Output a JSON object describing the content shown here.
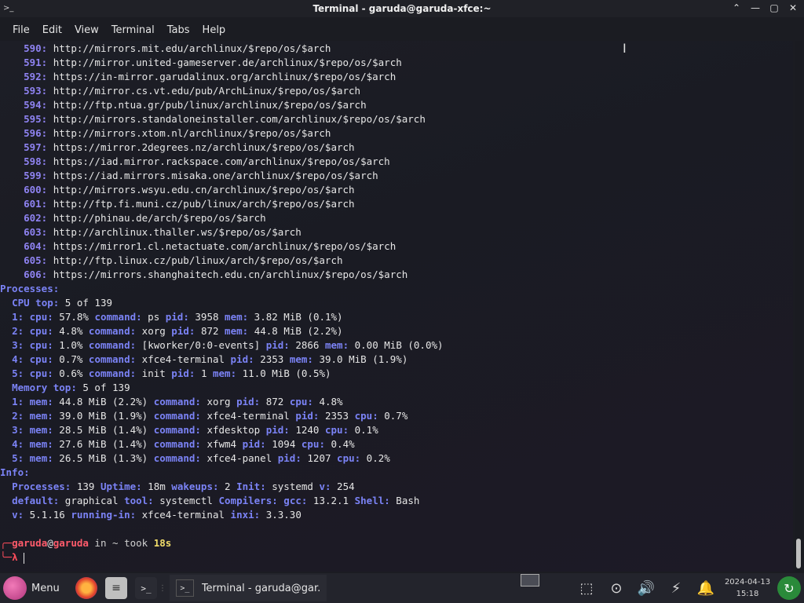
{
  "window": {
    "title": "Terminal - garuda@garuda-xfce:~"
  },
  "menu": [
    "File",
    "Edit",
    "View",
    "Terminal",
    "Tabs",
    "Help"
  ],
  "terminal": {
    "mirrors": [
      {
        "num": "590:",
        "url": "http://mirrors.mit.edu/archlinux/$repo/os/$arch"
      },
      {
        "num": "591:",
        "url": "http://mirror.united-gameserver.de/archlinux/$repo/os/$arch"
      },
      {
        "num": "592:",
        "url": "https://in-mirror.garudalinux.org/archlinux/$repo/os/$arch"
      },
      {
        "num": "593:",
        "url": "http://mirror.cs.vt.edu/pub/ArchLinux/$repo/os/$arch"
      },
      {
        "num": "594:",
        "url": "http://ftp.ntua.gr/pub/linux/archlinux/$repo/os/$arch"
      },
      {
        "num": "595:",
        "url": "http://mirrors.standaloneinstaller.com/archlinux/$repo/os/$arch"
      },
      {
        "num": "596:",
        "url": "http://mirrors.xtom.nl/archlinux/$repo/os/$arch"
      },
      {
        "num": "597:",
        "url": "https://mirror.2degrees.nz/archlinux/$repo/os/$arch"
      },
      {
        "num": "598:",
        "url": "https://iad.mirror.rackspace.com/archlinux/$repo/os/$arch"
      },
      {
        "num": "599:",
        "url": "https://iad.mirrors.misaka.one/archlinux/$repo/os/$arch"
      },
      {
        "num": "600:",
        "url": "http://mirrors.wsyu.edu.cn/archlinux/$repo/os/$arch"
      },
      {
        "num": "601:",
        "url": "http://ftp.fi.muni.cz/pub/linux/arch/$repo/os/$arch"
      },
      {
        "num": "602:",
        "url": "http://phinau.de/arch/$repo/os/$arch"
      },
      {
        "num": "603:",
        "url": "http://archlinux.thaller.ws/$repo/os/$arch"
      },
      {
        "num": "604:",
        "url": "https://mirror1.cl.netactuate.com/archlinux/$repo/os/$arch"
      },
      {
        "num": "605:",
        "url": "http://ftp.linux.cz/pub/linux/arch/$repo/os/$arch"
      },
      {
        "num": "606:",
        "url": "https://mirrors.shanghaitech.edu.cn/archlinux/$repo/os/$arch"
      }
    ],
    "processes_header": "Processes:",
    "cpu_top": {
      "label": "CPU top:",
      "value": "5 of 139"
    },
    "cpu_rows": [
      {
        "n": "1:",
        "cpu": "57.8%",
        "command": "ps",
        "pid": "3958",
        "mem": "3.82 MiB (0.1%)"
      },
      {
        "n": "2:",
        "cpu": "4.8%",
        "command": "xorg",
        "pid": "872",
        "mem": "44.8 MiB (2.2%)"
      },
      {
        "n": "3:",
        "cpu": "1.0%",
        "command": "[kworker/0:0-events]",
        "pid": "2866",
        "mem": "0.00 MiB (0.0%)"
      },
      {
        "n": "4:",
        "cpu": "0.7%",
        "command": "xfce4-terminal",
        "pid": "2353",
        "mem": "39.0 MiB (1.9%)"
      },
      {
        "n": "5:",
        "cpu": "0.6%",
        "command": "init",
        "pid": "1",
        "mem": "11.0 MiB (0.5%)"
      }
    ],
    "mem_top": {
      "label": "Memory top:",
      "value": "5 of 139"
    },
    "mem_rows": [
      {
        "n": "1:",
        "mem": "44.8 MiB (2.2%)",
        "command": "xorg",
        "pid": "872",
        "cpu": "4.8%"
      },
      {
        "n": "2:",
        "mem": "39.0 MiB (1.9%)",
        "command": "xfce4-terminal",
        "pid": "2353",
        "cpu": "0.7%"
      },
      {
        "n": "3:",
        "mem": "28.5 MiB (1.4%)",
        "command": "xfdesktop",
        "pid": "1240",
        "cpu": "0.1%"
      },
      {
        "n": "4:",
        "mem": "27.6 MiB (1.4%)",
        "command": "xfwm4",
        "pid": "1094",
        "cpu": "0.4%"
      },
      {
        "n": "5:",
        "mem": "26.5 MiB (1.3%)",
        "command": "xfce4-panel",
        "pid": "1207",
        "cpu": "0.2%"
      }
    ],
    "info_header": "Info:",
    "info": {
      "processes": "139",
      "uptime": "18m",
      "wakeups": "2",
      "init": "systemd",
      "v": "254",
      "default": "graphical",
      "tool": "systemctl",
      "gcc": "13.2.1",
      "shell": "Bash",
      "v2": "5.1.16",
      "running_in": "xfce4-terminal",
      "inxi": "3.3.30"
    },
    "prompt": {
      "user": "garuda",
      "at": "@",
      "host": "garuda",
      "in": "in",
      "dir": "~",
      "took": "took",
      "time": "18s",
      "lambda": "λ"
    }
  },
  "taskbar": {
    "menu_label": "Menu",
    "task_label": "Terminal - garuda@gar...",
    "date": "2024-04-13",
    "time": "15:18"
  },
  "colors": {
    "accent": "#7b83f6",
    "prompt_user": "#ff5b6b",
    "took": "#f2dd6a"
  }
}
